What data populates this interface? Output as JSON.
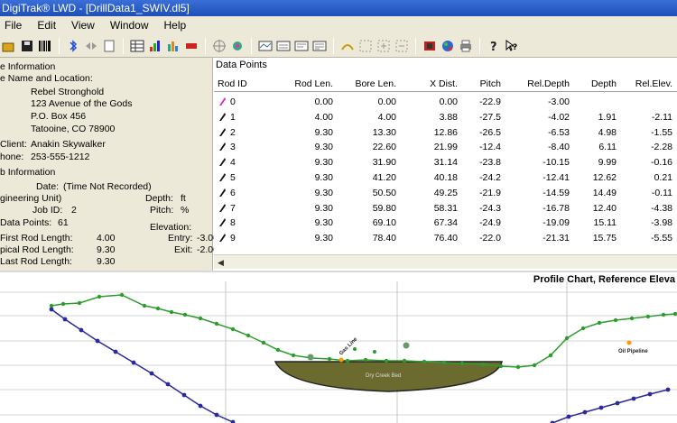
{
  "window": {
    "title": "DigiTrak® LWD - [DrillData1_SWIV.dl5]"
  },
  "menu": [
    "File",
    "Edit",
    "View",
    "Window",
    "Help"
  ],
  "toolbar_icons": [
    "open-icon",
    "save-icon",
    "barcode-icon",
    "bluetooth-icon",
    "transfer-icon",
    "page-icon",
    "table-icon",
    "chart-icon",
    "bar-chart-icon",
    "remove-icon",
    "target-icon",
    "settings-icon",
    "view1-icon",
    "view2-icon",
    "view3-icon",
    "view4-icon",
    "arc-icon",
    "zoom-fit-icon",
    "zoom-in-icon",
    "zoom-out-icon",
    "tools-icon",
    "globe-icon",
    "print-icon",
    "help-icon",
    "whats-this-icon"
  ],
  "job_info": {
    "section1": "e Information",
    "name_label": "e Name and Location:",
    "address": [
      "Rebel Stronghold",
      "123 Avenue of the Gods",
      "P.O. Box 456",
      "Tatooine, CO 78900"
    ],
    "client_label": "Client:",
    "client": "Anakin Skywalker",
    "phone_label": "hone:",
    "phone": "253-555-1212",
    "section2": "b Information",
    "date_label": "Date:",
    "date": "(Time Not Recorded)",
    "eng_unit": "gineering Unit)",
    "depth_label": "Depth:",
    "depth_unit": "ft",
    "jobid_label": "Job ID:",
    "jobid": "2",
    "pitch_label": "Pitch:",
    "pitch_unit": "%",
    "points_label": "Data Points:",
    "points": "61",
    "elev_label": "Elevation:",
    "first_label": "First Rod Length:",
    "first": "4.00",
    "entry_label": "Entry:",
    "entry": "-3.00",
    "typical_label": "pical Rod Length:",
    "typical": "9.30",
    "exit_label": "Exit:",
    "exit": "-2.00",
    "last_label": "Last Rod Length:",
    "last": "9.30"
  },
  "data_points": {
    "title": "Data Points",
    "headers": [
      "Rod ID",
      "Rod Len.",
      "Bore Len.",
      "X Dist.",
      "Pitch",
      "Rel.Depth",
      "Depth",
      "Rel.Elev."
    ],
    "rows": [
      [
        "0",
        "0.00",
        "0.00",
        "0.00",
        "-22.9",
        "-3.00",
        "",
        ""
      ],
      [
        "1",
        "4.00",
        "4.00",
        "3.88",
        "-27.5",
        "-4.02",
        "1.91",
        "-2.11"
      ],
      [
        "2",
        "9.30",
        "13.30",
        "12.86",
        "-26.5",
        "-6.53",
        "4.98",
        "-1.55"
      ],
      [
        "3",
        "9.30",
        "22.60",
        "21.99",
        "-12.4",
        "-8.40",
        "6.11",
        "-2.28"
      ],
      [
        "4",
        "9.30",
        "31.90",
        "31.14",
        "-23.8",
        "-10.15",
        "9.99",
        "-0.16"
      ],
      [
        "5",
        "9.30",
        "41.20",
        "40.18",
        "-24.2",
        "-12.41",
        "12.62",
        "0.21"
      ],
      [
        "6",
        "9.30",
        "50.50",
        "49.25",
        "-21.9",
        "-14.59",
        "14.49",
        "-0.11"
      ],
      [
        "7",
        "9.30",
        "59.80",
        "58.31",
        "-24.3",
        "-16.78",
        "12.40",
        "-4.38"
      ],
      [
        "8",
        "9.30",
        "69.10",
        "67.34",
        "-24.9",
        "-19.09",
        "15.11",
        "-3.98"
      ],
      [
        "9",
        "9.30",
        "78.40",
        "76.40",
        "-22.0",
        "-21.31",
        "15.75",
        "-5.55"
      ]
    ]
  },
  "chart": {
    "title": "Profile Chart, Reference Eleva",
    "labels": {
      "pipeline": "Oil Pipeline",
      "creek": "Dry Creek Bed",
      "gas": "Gas Line"
    },
    "colors": {
      "surface": "#2e9b2e",
      "bore": "#2a2a9a",
      "creek_fill": "#6b6b2f",
      "label": "#ff9900"
    }
  }
}
